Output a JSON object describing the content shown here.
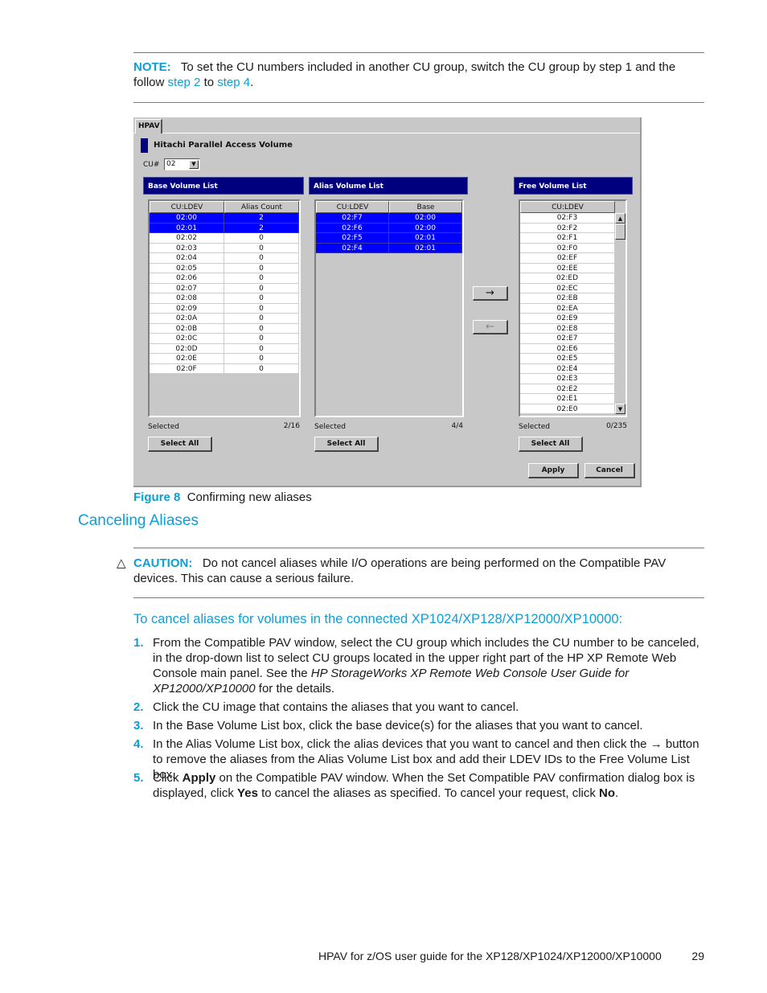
{
  "note": {
    "label": "NOTE:",
    "text_before": "To set the CU numbers included in another CU group, switch the CU group by step 1 and the follow ",
    "link1": "step 2",
    "mid": " to ",
    "link2": "step 4",
    "after": "."
  },
  "figure": {
    "window": {
      "tab": "HPAV",
      "title": "Hitachi Parallel Access Volume",
      "cu_label": "CU#",
      "cu_value": "02",
      "dropdown_glyph": "▼"
    },
    "base_list": {
      "title": "Base Volume List",
      "columns": [
        "CU:LDEV",
        "Alias Count"
      ],
      "rows": [
        {
          "ldev": "02:00",
          "count": "2",
          "selected": true
        },
        {
          "ldev": "02:01",
          "count": "2",
          "selected": true
        },
        {
          "ldev": "02:02",
          "count": "0",
          "selected": false
        },
        {
          "ldev": "02:03",
          "count": "0",
          "selected": false
        },
        {
          "ldev": "02:04",
          "count": "0",
          "selected": false
        },
        {
          "ldev": "02:05",
          "count": "0",
          "selected": false
        },
        {
          "ldev": "02:06",
          "count": "0",
          "selected": false
        },
        {
          "ldev": "02:07",
          "count": "0",
          "selected": false
        },
        {
          "ldev": "02:08",
          "count": "0",
          "selected": false
        },
        {
          "ldev": "02:09",
          "count": "0",
          "selected": false
        },
        {
          "ldev": "02:0A",
          "count": "0",
          "selected": false
        },
        {
          "ldev": "02:0B",
          "count": "0",
          "selected": false
        },
        {
          "ldev": "02:0C",
          "count": "0",
          "selected": false
        },
        {
          "ldev": "02:0D",
          "count": "0",
          "selected": false
        },
        {
          "ldev": "02:0E",
          "count": "0",
          "selected": false
        },
        {
          "ldev": "02:0F",
          "count": "0",
          "selected": false
        }
      ],
      "selected_label": "Selected",
      "selected_count": "2/16",
      "select_all": "Select All"
    },
    "alias_list": {
      "title": "Alias Volume List",
      "columns": [
        "CU:LDEV",
        "Base"
      ],
      "rows": [
        {
          "ldev": "02:F7",
          "base": "02:00",
          "selected": true
        },
        {
          "ldev": "02:F6",
          "base": "02:00",
          "selected": true
        },
        {
          "ldev": "02:F5",
          "base": "02:01",
          "selected": true
        },
        {
          "ldev": "02:F4",
          "base": "02:01",
          "selected": true
        }
      ],
      "selected_label": "Selected",
      "selected_count": "4/4",
      "select_all": "Select All"
    },
    "move_right": "→",
    "move_left": "←",
    "free_list": {
      "title": "Free Volume List",
      "columns": [
        "CU:LDEV"
      ],
      "rows": [
        "02:F3",
        "02:F2",
        "02:F1",
        "02:F0",
        "02:EF",
        "02:EE",
        "02:ED",
        "02:EC",
        "02:EB",
        "02:EA",
        "02:E9",
        "02:E8",
        "02:E7",
        "02:E6",
        "02:E5",
        "02:E4",
        "02:E3",
        "02:E2",
        "02:E1",
        "02:E0"
      ],
      "selected_label": "Selected",
      "selected_count": "0/235",
      "select_all": "Select All",
      "scroll_up": "▲",
      "scroll_down": "▼"
    },
    "apply": "Apply",
    "cancel": "Cancel",
    "caption_label": "Figure 8",
    "caption_text": "Confirming new aliases"
  },
  "section_title": "Canceling Aliases",
  "caution": {
    "icon": "△",
    "label": "CAUTION:",
    "text": "Do not cancel aliases while I/O operations are being performed on the Compatible PAV devices. This can cause a serious failure."
  },
  "procedure_title": "To cancel aliases for volumes in the connected XP1024/XP128/XP12000/XP10000:",
  "steps": [
    {
      "num": "1.",
      "parts": [
        {
          "t": "From the Compatible PAV window, select the CU group which includes the CU number to be canceled, in the drop-down list to select CU groups located in the upper right part of the HP XP Remote Web Console main panel. See the "
        },
        {
          "t": "HP StorageWorks XP Remote Web Console User Guide for XP12000/XP10000",
          "i": true
        },
        {
          "t": " for the details."
        }
      ]
    },
    {
      "num": "2.",
      "parts": [
        {
          "t": "Click the CU image that contains the aliases that you want to cancel."
        }
      ]
    },
    {
      "num": "3.",
      "parts": [
        {
          "t": "In the Base Volume List box, click the base device(s) for the aliases that you want to cancel."
        }
      ]
    },
    {
      "num": "4.",
      "parts": [
        {
          "t": "In the Alias Volume List box, click the alias devices that you want to cancel and then click the "
        },
        {
          "t": "→",
          "b": true
        },
        {
          "t": " button to remove the aliases from the Alias Volume List box and add their LDEV IDs to the Free Volume List box."
        }
      ]
    },
    {
      "num": "5.",
      "parts": [
        {
          "t": "Click "
        },
        {
          "t": "Apply",
          "b": true
        },
        {
          "t": " on the Compatible PAV window. When the Set Compatible PAV confirmation dialog box is displayed, click "
        },
        {
          "t": "Yes",
          "b": true
        },
        {
          "t": " to cancel the aliases as specified. To cancel your request, click "
        },
        {
          "t": "No",
          "b": true
        },
        {
          "t": "."
        }
      ]
    }
  ],
  "footer": {
    "text": "HPAV for z/OS user guide for the XP128/XP1024/XP12000/XP10000",
    "page": "29"
  },
  "colors": {
    "accent": "#0a9fd8",
    "panel_header": "#00007f",
    "selection": "#0000ff",
    "window_bg": "#c8c8c8"
  }
}
